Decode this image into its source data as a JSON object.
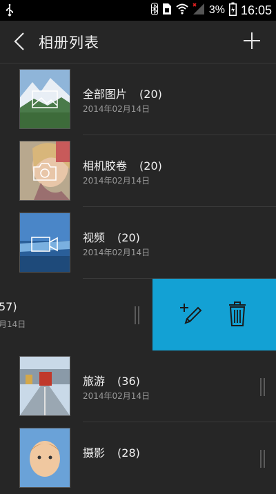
{
  "status_bar": {
    "battery_percent": "3%",
    "time": "16:05"
  },
  "header": {
    "title": "相册列表",
    "back_icon": "chevron-left-icon",
    "add_icon": "plus-icon"
  },
  "albums": [
    {
      "name": "全部图片",
      "count": "(20)",
      "date": "2014年02月14日",
      "thumb_icon": "image-icon"
    },
    {
      "name": "相机胶卷",
      "count": "(20)",
      "date": "2014年02月14日",
      "thumb_icon": "camera-icon"
    },
    {
      "name": "视频",
      "count": "(20)",
      "date": "2014年02月14日",
      "thumb_icon": "video-icon"
    },
    {
      "name": "",
      "count": "57)",
      "date": "月14日",
      "swiped": true
    },
    {
      "name": "旅游",
      "count": "(36)",
      "date": "2014年02月14日"
    },
    {
      "name": "摄影",
      "count": "(28)",
      "date": ""
    }
  ],
  "swipe_actions": {
    "edit_icon": "add-edit-icon",
    "delete_icon": "trash-icon",
    "background": "#13a1d4"
  }
}
